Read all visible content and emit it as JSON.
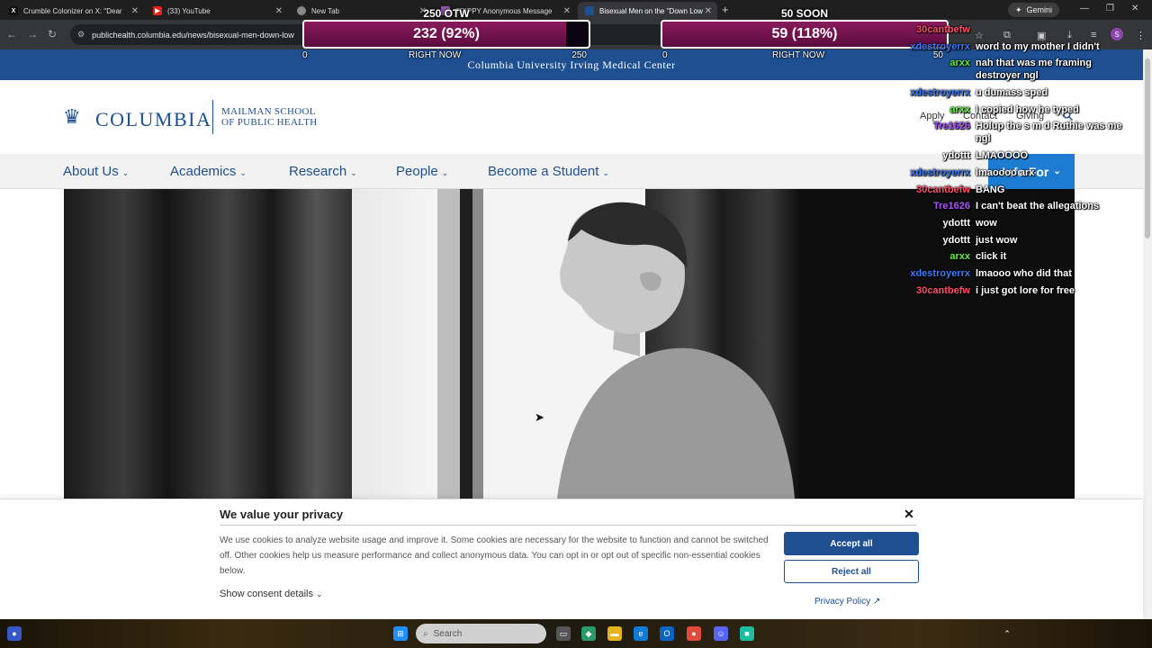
{
  "browser": {
    "tabs": [
      {
        "label": "Crumble Colonizer on X: \"Dear",
        "icon": "x-logo-icon",
        "color": "#111111"
      },
      {
        "label": "(33) YouTube",
        "icon": "youtube-icon",
        "color": "#e62117"
      },
      {
        "label": "New Tab",
        "icon": "chrome-icon",
        "color": "#888888"
      },
      {
        "label": "TRIPPY Anonymous Message",
        "icon": "message-icon",
        "color": "#9b59b6"
      },
      {
        "label": "Bisexual Men on the \"Down Low",
        "icon": "columbia-icon",
        "color": "#1d4f91"
      }
    ],
    "gemini_label": "Gemini",
    "url": "publichealth.columbia.edu/news/bisexual-men-down-low"
  },
  "goals": [
    {
      "title": "250 OTW",
      "value_text": "232 (92%)",
      "fill_fraction": 0.92,
      "min": "0",
      "mid": "RIGHT NOW",
      "max": "250"
    },
    {
      "title": "50 SOON",
      "value_text": "59 (118%)",
      "fill_fraction": 1.0,
      "min": "0",
      "mid": "RIGHT NOW",
      "max": "50"
    }
  ],
  "site": {
    "top_bar": "Columbia University Irving Medical Center",
    "wordmark": "COLUMBIA",
    "school_line1": "MAILMAN SCHOOL",
    "school_line2": "OF PUBLIC HEALTH",
    "utility_links": [
      "Apply",
      "Contact",
      "Giving"
    ],
    "nav": [
      "About Us",
      "Academics",
      "Research",
      "People",
      "Become a Student"
    ],
    "info_for": "Info For"
  },
  "chat": [
    {
      "user": "30cantbefw",
      "text": "",
      "color": "#ff4f6a"
    },
    {
      "user": "xdestroyerrx",
      "text": "word to my mother I didn't",
      "color": "#3a7bff"
    },
    {
      "user": "arxx",
      "text": "nah that was me framing destroyer ngl",
      "color": "#5ef03c"
    },
    {
      "user": "xdestroyerrx",
      "text": "u dumass sped",
      "color": "#3a7bff"
    },
    {
      "user": "arxx",
      "text": "I copied how he typed",
      "color": "#5ef03c"
    },
    {
      "user": "Tre1626",
      "text": "Holup the s m d Ruthie was me ngl",
      "color": "#a855f7"
    },
    {
      "user": "ydottt",
      "text": "LMAOOOO",
      "color": "#ffffff"
    },
    {
      "user": "xdestroyerrx",
      "text": "lmaoooo arx",
      "color": "#3a7bff"
    },
    {
      "user": "30cantbefw",
      "text": "BANG",
      "color": "#ff4f6a"
    },
    {
      "user": "Tre1626",
      "text": "I can't beat the allegations",
      "color": "#a855f7"
    },
    {
      "user": "ydottt",
      "text": "wow",
      "color": "#ffffff"
    },
    {
      "user": "ydottt",
      "text": "just wow",
      "color": "#ffffff"
    },
    {
      "user": "arxx",
      "text": "click it",
      "color": "#5ef03c"
    },
    {
      "user": "xdestroyerrx",
      "text": "lmaooo who did that",
      "color": "#3a7bff"
    },
    {
      "user": "30cantbefw",
      "text": "i just got lore for free",
      "color": "#ff4f6a"
    }
  ],
  "cookie": {
    "title": "We value your privacy",
    "body": "We use cookies to analyze website usage and improve it. Some cookies are necessary for the website to function and cannot be switched off. Other cookies help us measure performance and collect anonymous data. You can opt in or opt out of specific non-essential cookies below.",
    "details": "Show consent details",
    "accept": "Accept all",
    "reject": "Reject all",
    "policy": "Privacy Policy"
  },
  "taskbar": {
    "search_placeholder": "Search"
  }
}
